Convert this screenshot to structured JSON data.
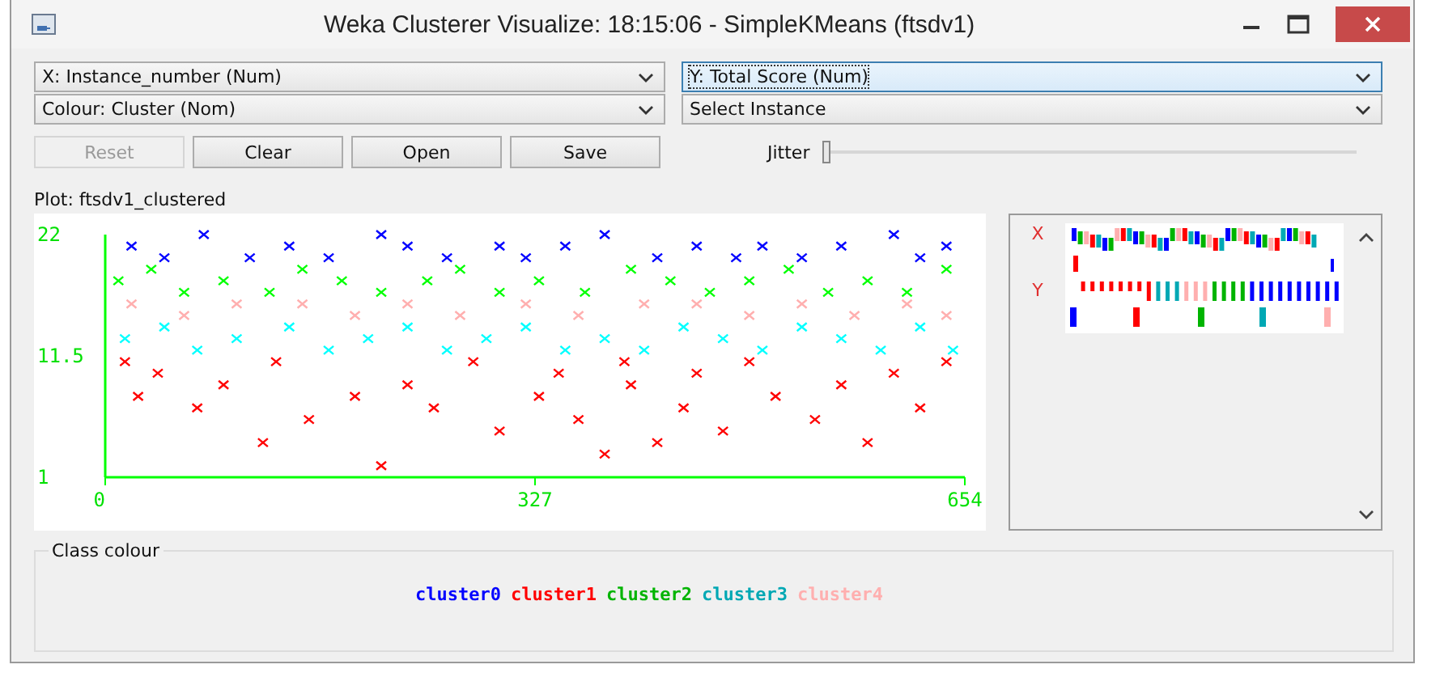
{
  "window": {
    "title": "Weka Clusterer Visualize: 18:15:06 - SimpleKMeans (ftsdv1)"
  },
  "selectors": [
    {
      "label": "X: Instance_number (Num)",
      "focused": false
    },
    {
      "label": "Y: Total Score (Num)",
      "focused": true
    },
    {
      "label": "Colour: Cluster (Nom)",
      "focused": false
    },
    {
      "label": "Select Instance",
      "focused": false
    }
  ],
  "buttons": [
    {
      "label": "Reset",
      "disabled": true
    },
    {
      "label": "Clear",
      "disabled": false
    },
    {
      "label": "Open",
      "disabled": false
    },
    {
      "label": "Save",
      "disabled": false
    }
  ],
  "jitter": {
    "label": "Jitter",
    "level": 0
  },
  "plot": {
    "title": "Plot: ftsdv1_clustered",
    "chart_data": {
      "type": "scatter",
      "xlim": [
        0,
        654
      ],
      "ylim": [
        1,
        22
      ],
      "xticks": [
        0,
        327,
        654
      ],
      "yticks": [
        1,
        11.5,
        22
      ],
      "series": [
        {
          "color": "#0000ff",
          "x": [
            20,
            45,
            75,
            110,
            140,
            170,
            210,
            230,
            260,
            300,
            320,
            350,
            380,
            420,
            450,
            480,
            500,
            530,
            560,
            600,
            620,
            640
          ],
          "values": [
            21,
            20,
            22,
            20,
            21,
            20,
            22,
            21,
            20,
            21,
            20,
            21,
            22,
            20,
            21,
            20,
            21,
            20,
            21,
            22,
            20,
            21
          ]
        },
        {
          "color": "#ff0000",
          "x": [
            15,
            25,
            40,
            70,
            90,
            120,
            130,
            155,
            190,
            210,
            230,
            250,
            280,
            300,
            330,
            345,
            360,
            380,
            395,
            400,
            420,
            440,
            450,
            470,
            490,
            510,
            540,
            560,
            580,
            600,
            620,
            640
          ],
          "values": [
            11,
            8,
            10,
            7,
            9,
            4,
            11,
            6,
            8,
            2,
            9,
            7,
            11,
            5,
            8,
            10,
            6,
            3,
            11,
            9,
            4,
            7,
            10,
            5,
            11,
            8,
            6,
            9,
            4,
            10,
            7,
            11
          ]
        },
        {
          "color": "#00ff00",
          "x": [
            10,
            35,
            60,
            90,
            125,
            150,
            180,
            210,
            245,
            270,
            300,
            330,
            365,
            400,
            430,
            460,
            490,
            520,
            550,
            580,
            610,
            640
          ],
          "values": [
            18,
            19,
            17,
            18,
            17,
            19,
            18,
            17,
            18,
            19,
            17,
            18,
            17,
            19,
            18,
            17,
            18,
            19,
            17,
            18,
            17,
            19
          ]
        },
        {
          "color": "#00ffff",
          "x": [
            15,
            45,
            70,
            100,
            140,
            170,
            200,
            230,
            260,
            290,
            320,
            350,
            380,
            410,
            440,
            470,
            500,
            530,
            560,
            590,
            620,
            645
          ],
          "values": [
            13,
            14,
            12,
            13,
            14,
            12,
            13,
            14,
            12,
            13,
            14,
            12,
            13,
            12,
            14,
            13,
            12,
            14,
            13,
            12,
            14,
            12
          ]
        },
        {
          "color": "#ffafaf",
          "x": [
            20,
            60,
            100,
            150,
            190,
            230,
            270,
            320,
            360,
            410,
            450,
            490,
            530,
            570,
            610,
            640
          ],
          "values": [
            16,
            15,
            16,
            16,
            15,
            16,
            15,
            16,
            15,
            16,
            16,
            15,
            16,
            15,
            16,
            15
          ]
        }
      ]
    }
  },
  "attribute_panel": {
    "labels": [
      "X",
      "Y"
    ]
  },
  "class_colour": {
    "title": "Class colour",
    "items": [
      {
        "label": "cluster0",
        "color": "#0000ff"
      },
      {
        "label": "cluster1",
        "color": "#ff0000"
      },
      {
        "label": "cluster2",
        "color": "#00b400"
      },
      {
        "label": "cluster3",
        "color": "#00a8b4"
      },
      {
        "label": "cluster4",
        "color": "#ffafaf"
      }
    ]
  }
}
